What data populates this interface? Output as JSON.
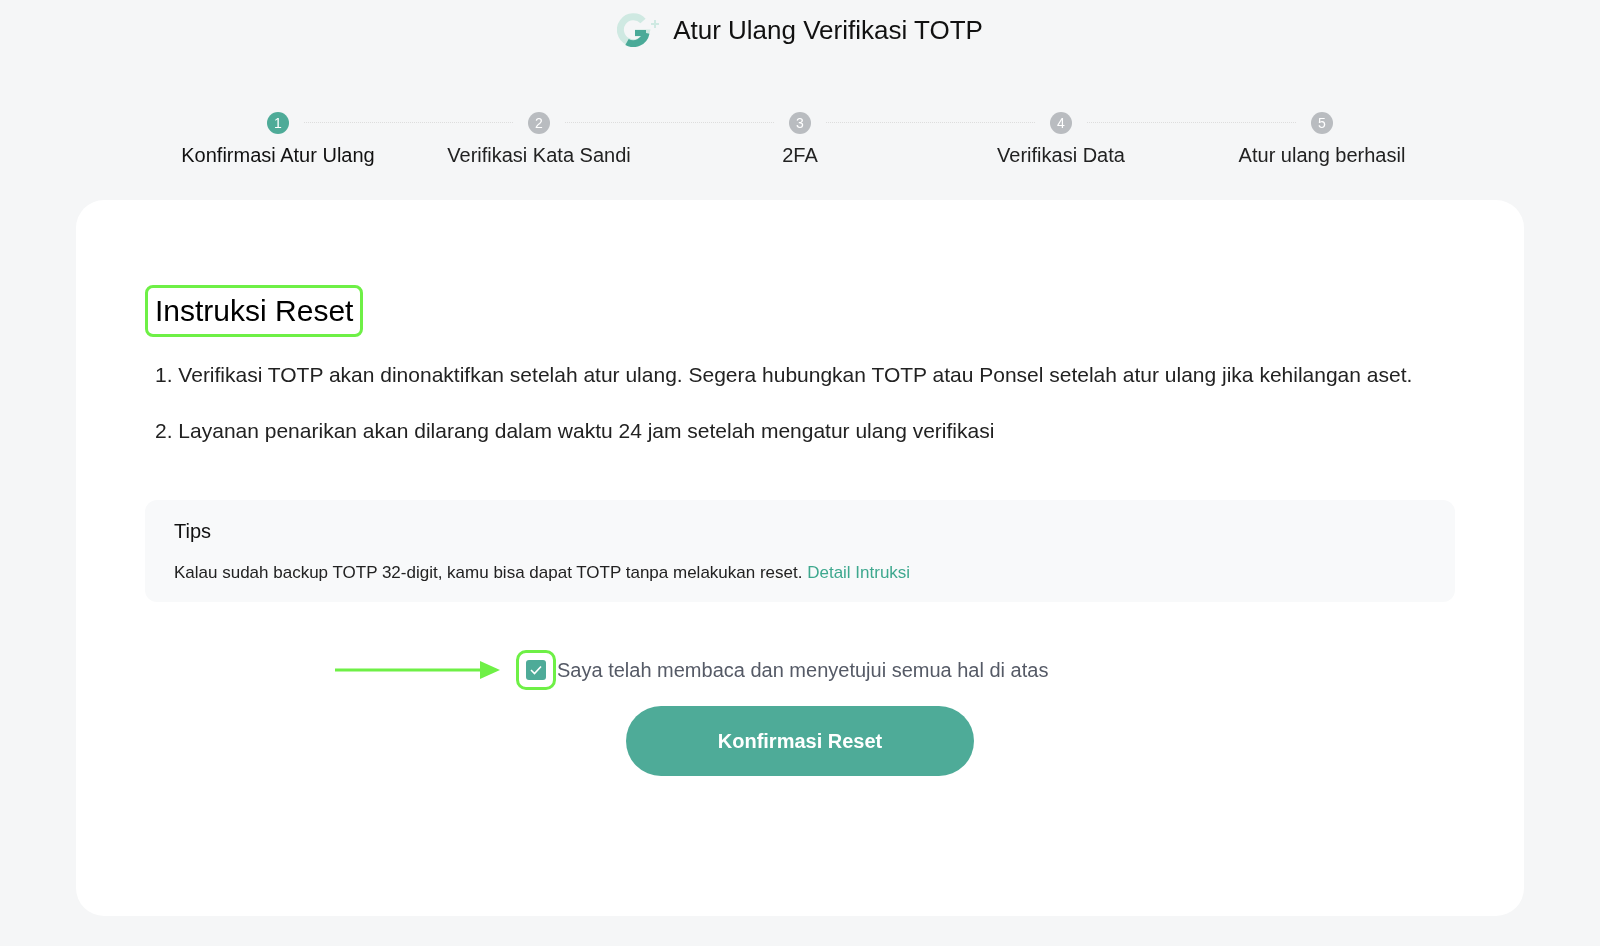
{
  "header": {
    "title": "Atur Ulang Verifikasi TOTP"
  },
  "steps": [
    {
      "number": "1",
      "label": "Konfirmasi Atur Ulang",
      "selected": true
    },
    {
      "number": "2",
      "label": "Verifikasi Kata Sandi",
      "selected": false
    },
    {
      "number": "3",
      "label": "2FA",
      "selected": false
    },
    {
      "number": "4",
      "label": "Verifikasi Data",
      "selected": false
    },
    {
      "number": "5",
      "label": "Atur ulang berhasil",
      "selected": false
    }
  ],
  "card": {
    "heading": "Instruksi Reset",
    "instructions": [
      "1. Verifikasi TOTP akan dinonaktifkan setelah atur ulang. Segera hubungkan TOTP atau Ponsel setelah atur ulang jika kehilangan aset.",
      "2. Layanan penarikan akan dilarang dalam waktu 24 jam setelah mengatur ulang verifikasi"
    ],
    "tips": {
      "title": "Tips",
      "text": "Kalau sudah backup TOTP 32-digit, kamu bisa dapat TOTP tanpa melakukan reset.",
      "link": "Detail Intruksi"
    },
    "agreement": {
      "label": "Saya telah membaca dan menyetujui semua hal di atas",
      "checked": true
    },
    "button": "Konfirmasi Reset"
  }
}
